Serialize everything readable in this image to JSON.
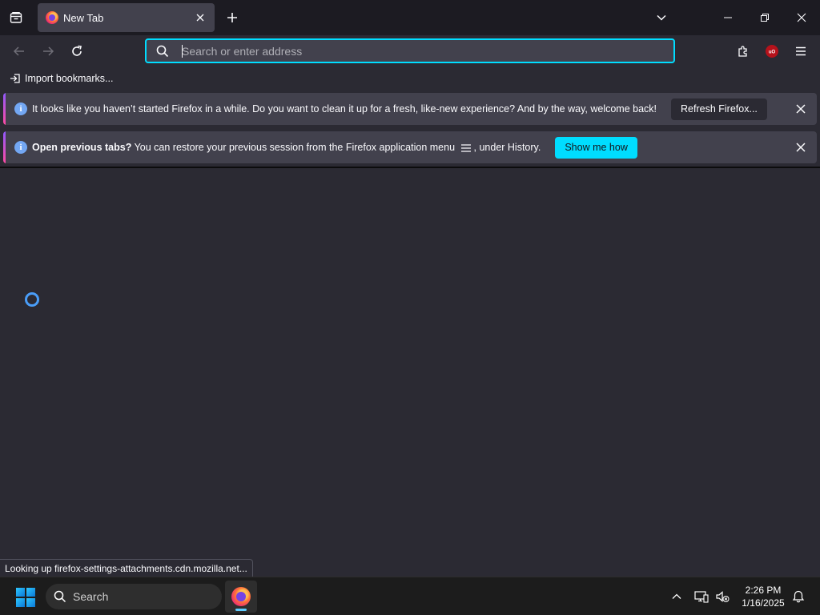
{
  "tabstrip": {
    "tab_title": "New Tab"
  },
  "navbar": {
    "url_placeholder": "Search or enter address",
    "url_value": ""
  },
  "bookmarks": {
    "import_label": "Import bookmarks..."
  },
  "notifications": [
    {
      "message": "It looks like you haven’t started Firefox in a while. Do you want to clean it up for a fresh, like-new experience? And by the way, welcome back!",
      "action_label": "Refresh Firefox..."
    },
    {
      "message_bold": "Open previous tabs?",
      "message_pre": " You can restore your previous session from the Firefox application menu ",
      "message_post": ", under History.",
      "action_label": "Show me how"
    }
  ],
  "status_text": "Looking up firefox-settings-attachments.cdn.mozilla.net...",
  "taskbar": {
    "search_label": "Search",
    "time": "2:26 PM",
    "date": "1/16/2025"
  },
  "colors": {
    "accent": "#00ddff",
    "toolbar_bg": "#2b2a33",
    "tabstrip_bg": "#1c1b22",
    "notification_bg": "#42414d",
    "extension_badge": "#b5121b"
  },
  "icons": {
    "firefox_view": "firefox-view-icon",
    "tab_close": "close-icon",
    "new_tab": "plus-icon",
    "tab_list": "chevron-down-icon",
    "minimize": "minimize-icon",
    "restore": "restore-icon",
    "window_close": "close-icon",
    "back": "back-arrow-icon",
    "forward": "forward-arrow-icon",
    "reload": "reload-icon",
    "search": "search-icon",
    "extensions": "puzzle-icon",
    "ublock": "ublock-origin-icon",
    "app_menu": "hamburger-menu-icon",
    "info": "info-icon",
    "spinner": "loading-spinner-icon",
    "start": "windows-start-icon",
    "tray_up": "chevron-up-icon",
    "network": "network-icon",
    "volume": "volume-muted-icon",
    "notifications": "bell-icon"
  }
}
